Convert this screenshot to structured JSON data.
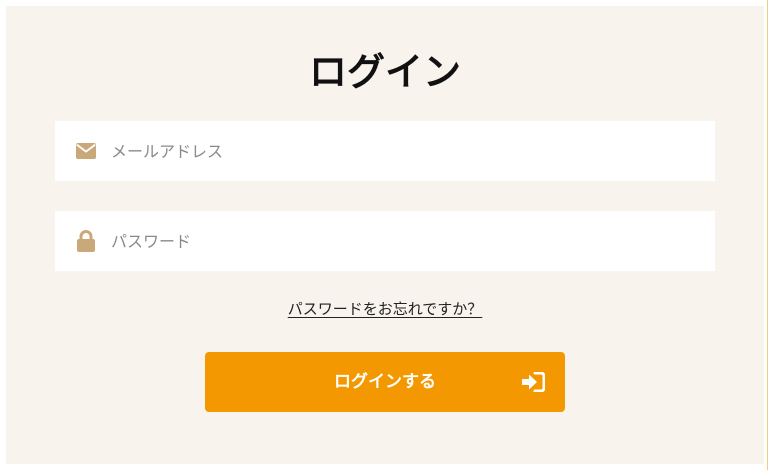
{
  "title": "ログイン",
  "form": {
    "email": {
      "placeholder": "メールアドレス",
      "value": "",
      "icon": "envelope-icon"
    },
    "password": {
      "placeholder": "パスワード",
      "value": "",
      "icon": "lock-icon"
    },
    "forgot_link": "パスワードをお忘れですか？",
    "submit_label": "ログインする",
    "submit_icon": "sign-in-icon"
  },
  "colors": {
    "panel_background": "#f8f3ed",
    "icon_tan": "#c9a97a",
    "button_orange": "#f39800",
    "button_text": "#ffffff"
  }
}
